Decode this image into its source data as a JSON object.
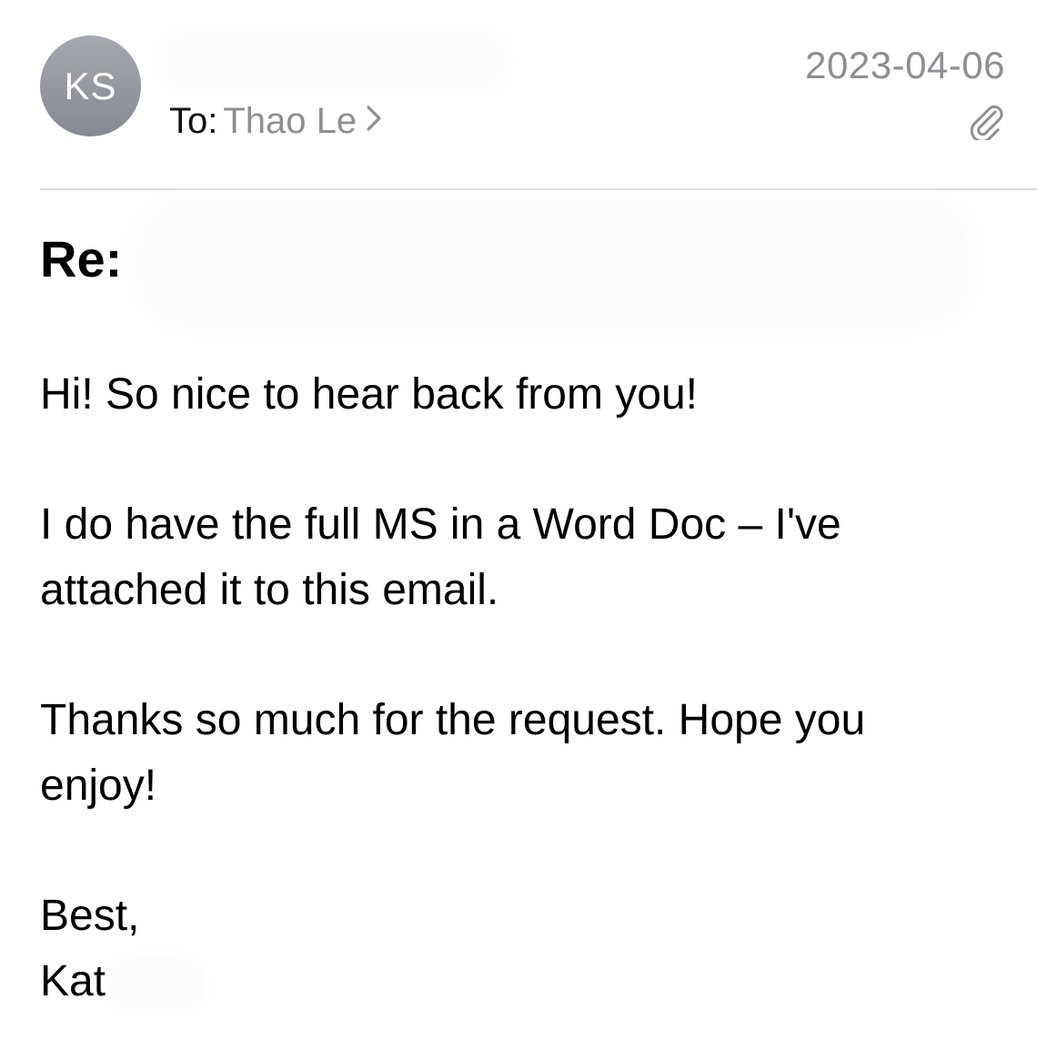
{
  "header": {
    "avatar_initials": "KS",
    "to_label": "To:",
    "to_name": "Thao Le",
    "date": "2023-04-06",
    "attachment_icon": "paperclip-icon",
    "chevron_icon": "chevron-right-icon"
  },
  "subject": {
    "prefix": "Re:"
  },
  "body": {
    "greeting": "Hi! So nice to hear back from you!",
    "paragraph_1": "I do have the full MS in a Word Doc – I've attached it to this email.",
    "paragraph_2": "Thanks so much for the request. Hope you enjoy!",
    "sign_off": "Best,",
    "signature": "Kat"
  },
  "colors": {
    "avatar_bg": "#9a9ca4",
    "secondary_text": "#8e8e93",
    "divider": "#d8d8dc"
  }
}
